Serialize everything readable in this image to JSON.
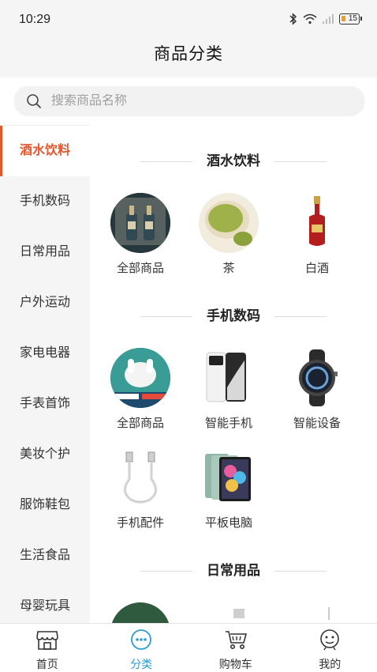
{
  "status_bar": {
    "time": "10:29",
    "battery": "15"
  },
  "header": {
    "title": "商品分类"
  },
  "search": {
    "placeholder": "搜索商品名称"
  },
  "sidebar": {
    "items": [
      {
        "label": "酒水饮料",
        "active": true
      },
      {
        "label": "手机数码"
      },
      {
        "label": "日常用品"
      },
      {
        "label": "户外运动"
      },
      {
        "label": "家电电器"
      },
      {
        "label": "手表首饰"
      },
      {
        "label": "美妆个护"
      },
      {
        "label": "服饰鞋包"
      },
      {
        "label": "生活食品"
      },
      {
        "label": "母婴玩具"
      }
    ]
  },
  "sections": [
    {
      "title": "酒水饮料",
      "items": [
        {
          "label": "全部商品"
        },
        {
          "label": "茶"
        },
        {
          "label": "白酒"
        }
      ]
    },
    {
      "title": "手机数码",
      "items": [
        {
          "label": "全部商品"
        },
        {
          "label": "智能手机"
        },
        {
          "label": "智能设备"
        },
        {
          "label": "手机配件"
        },
        {
          "label": "平板电脑"
        }
      ]
    },
    {
      "title": "日常用品",
      "items": []
    }
  ],
  "tabbar": {
    "items": [
      {
        "label": "首页",
        "icon": "store-icon"
      },
      {
        "label": "分类",
        "icon": "category-icon",
        "active": true
      },
      {
        "label": "购物车",
        "icon": "cart-icon"
      },
      {
        "label": "我的",
        "icon": "profile-icon"
      }
    ]
  },
  "colors": {
    "accent": "#e4572e",
    "tab_active": "#2a9bd6"
  }
}
